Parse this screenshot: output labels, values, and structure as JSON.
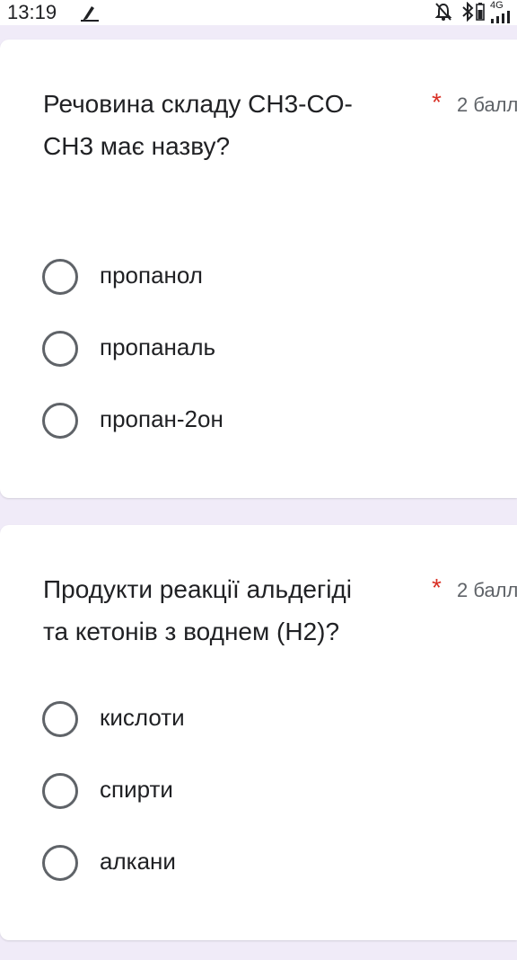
{
  "status_bar": {
    "time": "13:19",
    "left_icon": "sweep-notification-icon",
    "icons": [
      "mute-bell-icon",
      "bluetooth-icon",
      "battery-icon",
      "4g-signal-icon"
    ],
    "network_label": "4G"
  },
  "questions": [
    {
      "title_line1": "Речовина складу CH3-CO-",
      "title_line2": "CH3 має назву?",
      "required_mark": "*",
      "points": "2 балл",
      "options": [
        "пропанол",
        "пропаналь",
        "пропан-2он"
      ]
    },
    {
      "title_line1": "Продукти реакції альдегіді",
      "title_line2": "та кетонів з воднем (H2)?",
      "required_mark": "*",
      "points": "2 балл",
      "options": [
        "кислоти",
        "спирти",
        "алкани"
      ]
    }
  ],
  "colors": {
    "background": "#f0ebf8",
    "required": "#d93025",
    "radio_border": "#5f6368",
    "text": "#202124"
  }
}
